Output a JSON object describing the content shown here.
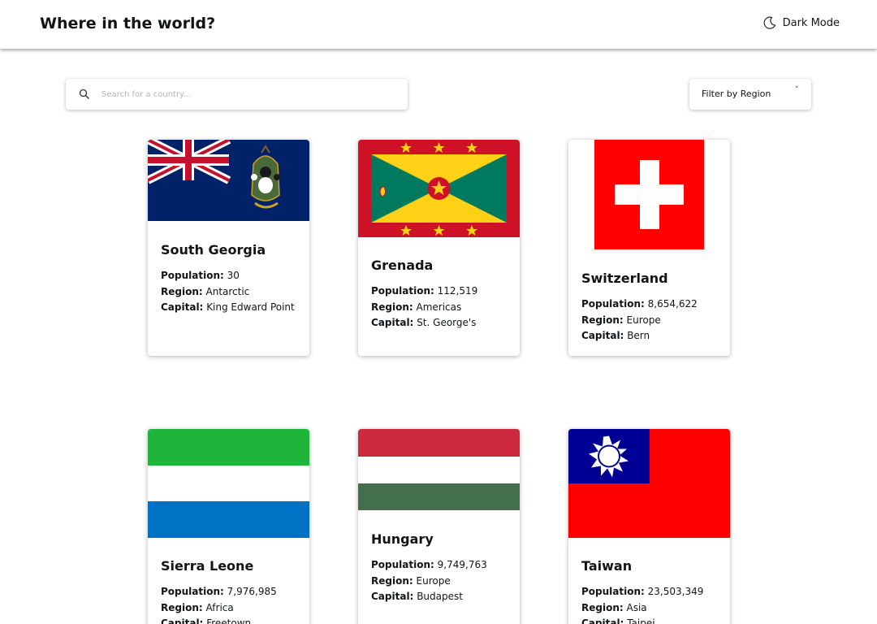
{
  "header": {
    "title": "Where in the world?",
    "mode_label": "Dark Mode",
    "mode_icon": "moon-icon"
  },
  "search": {
    "placeholder": "Search for a country...",
    "icon": "search-icon"
  },
  "filter": {
    "label": "Filter by Region",
    "icon": "chevron-down-icon"
  },
  "labels": {
    "population": "Population:",
    "region": "Region:",
    "capital": "Capital:"
  },
  "countries": [
    {
      "name": "South Georgia",
      "population": "30",
      "region": "Antarctic",
      "capital": "King Edward Point"
    },
    {
      "name": "Grenada",
      "population": "112,519",
      "region": "Americas",
      "capital": "St. George's"
    },
    {
      "name": "Switzerland",
      "population": "8,654,622",
      "region": "Europe",
      "capital": "Bern"
    },
    {
      "name": "Sierra Leone",
      "population": "7,976,985",
      "region": "Africa",
      "capital": "Freetown"
    },
    {
      "name": "Hungary",
      "population": "9,749,763",
      "region": "Europe",
      "capital": "Budapest"
    },
    {
      "name": "Taiwan",
      "population": "23,503,349",
      "region": "Asia",
      "capital": "Taipei"
    }
  ]
}
